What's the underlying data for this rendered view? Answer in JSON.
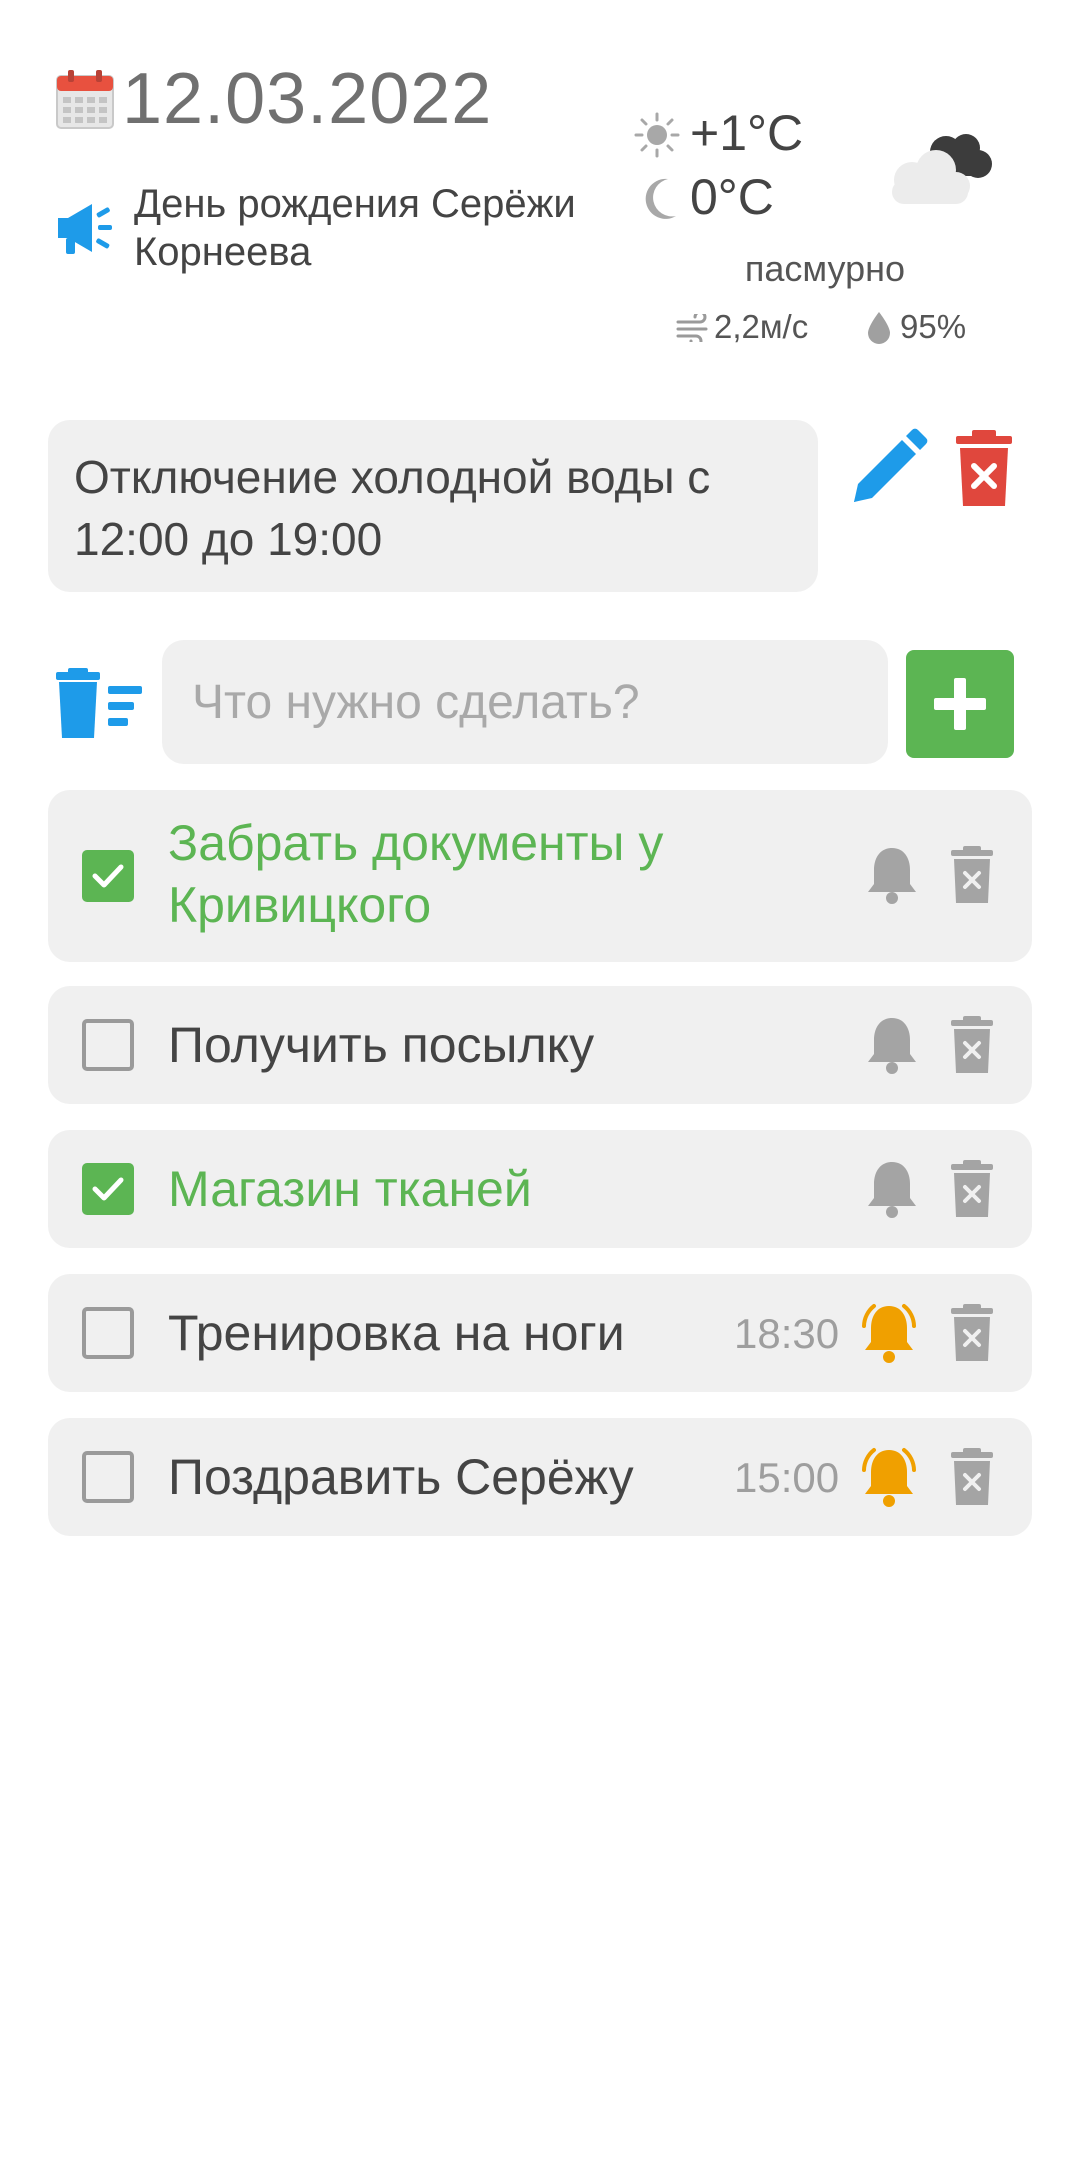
{
  "header": {
    "date": "12.03.2022",
    "event": "День рождения Серёжи Корнеева",
    "icons": {
      "calendar": "calendar-icon",
      "event": "megaphone-icon"
    }
  },
  "weather": {
    "day_temp": "+1°C",
    "night_temp": "0°C",
    "condition": "пасмурно",
    "wind": "2,2м/с",
    "humidity": "95%",
    "icons": {
      "day": "sun-icon",
      "night": "moon-icon",
      "condition": "cloud-icon",
      "wind": "wind-icon",
      "humidity": "drop-icon"
    }
  },
  "note": {
    "text": "Отключение холодной воды с 12:00 до 19:00",
    "edit_icon": "pencil-icon",
    "delete_icon": "trash-icon"
  },
  "new_task": {
    "placeholder": "Что нужно сделать?",
    "add_icon": "plus-icon",
    "clear_icon": "clear-list-icon"
  },
  "tasks": [
    {
      "title": "Забрать документы у Кривицкого",
      "done": true,
      "time": "",
      "alarm": false
    },
    {
      "title": "Получить посылку",
      "done": false,
      "time": "",
      "alarm": false
    },
    {
      "title": "Магазин тканей",
      "done": true,
      "time": "",
      "alarm": false
    },
    {
      "title": "Тренировка на ноги",
      "done": false,
      "time": "18:30",
      "alarm": true
    },
    {
      "title": "Поздравить Серёжу",
      "done": false,
      "time": "15:00",
      "alarm": true
    }
  ],
  "colors": {
    "accent_green": "#5cb553",
    "accent_blue": "#1e9be9",
    "danger_red": "#e0473d",
    "alarm_orange": "#f0a000",
    "card_bg": "#f0f0f0"
  }
}
